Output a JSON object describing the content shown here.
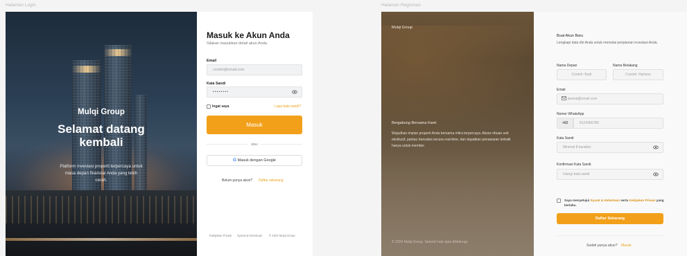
{
  "captions": {
    "login": "Halaman Login",
    "register": "Halaman Registrasi"
  },
  "login": {
    "hero": {
      "brand": "Mulqi Group",
      "welcome": "Selamat datang kembali",
      "description": "Platform investasi properti terpercaya untuk masa depan finansial Anda yang lebih cerah."
    },
    "form": {
      "title": "Masuk ke Akun Anda",
      "subtitle": "Silakan masukkan detail akun Anda.",
      "email_label": "Email",
      "email_placeholder": "contoh@email.com",
      "password_label": "Kata Sandi",
      "password_value": "••••••••",
      "remember": "Ingat saya",
      "forgot": "Lupa kata sandi?",
      "submit": "Masuk",
      "or": "atau",
      "google": "Masuk dengan Google",
      "no_account": "Belum punya akun?",
      "register_link": "Daftar sekarang"
    },
    "footer": {
      "privacy": "Kebijakan Privasi",
      "terms": "Syarat & Ketentuan",
      "copyright": "© 2024 Mulqi Group"
    }
  },
  "register": {
    "hero": {
      "brand": "Mulqi Group",
      "title": "Bergabung Bersama Kami",
      "description": "Wujudkan impian properti Anda bersama mitra terpercaya. Akses ribuan unit eksklusif, pantau transaksi secara real-time, dan dapatkan penawaran terbaik hanya untuk member.",
      "copyright": "© 2024 Mulqi Group. Seluruh hak cipta dilindungi."
    },
    "form": {
      "title": "Buat Akun Baru",
      "subtitle": "Lengkapi data diri Anda untuk memulai perjalanan investasi Anda.",
      "first_name_label": "Nama Depan",
      "first_name_placeholder": "Contoh: Budi",
      "last_name_label": "Nama Belakang",
      "last_name_placeholder": "Contoh: Hartono",
      "email_label": "Email",
      "email_placeholder": "alamat@email.com",
      "phone_label": "Nomor WhatsApp",
      "phone_prefix": "+62",
      "phone_placeholder": "8123456789",
      "password_label": "Kata Sandi",
      "password_placeholder": "Minimal 8 karakter",
      "confirm_label": "Konfirmasi Kata Sandi",
      "confirm_placeholder": "Ulangi kata sandi",
      "terms_prefix": "Saya menyetujui ",
      "terms_link": "Syarat & Ketentuan",
      "terms_mid": " serta ",
      "privacy_link": "Kebijakan Privasi",
      "terms_suffix": " yang berlaku.",
      "submit": "Daftar Sekarang",
      "have_account": "Sudah punya akun?",
      "login_link": "Masuk"
    }
  },
  "colors": {
    "accent": "#f2a01a",
    "link": "#e9a21a"
  }
}
